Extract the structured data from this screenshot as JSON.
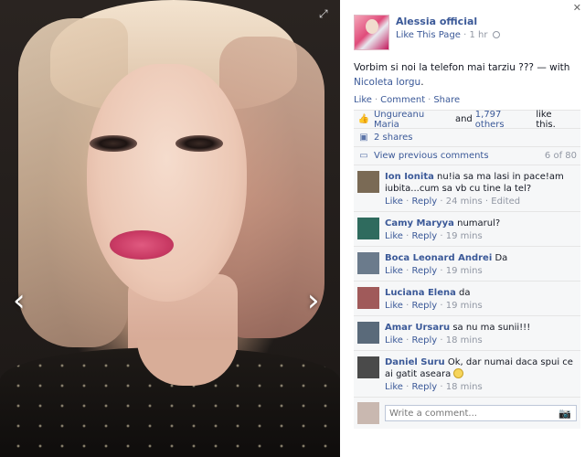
{
  "photo_viewer": {
    "prev_arrow": "‹",
    "next_arrow": "›",
    "expand_glyph": "⤢"
  },
  "post": {
    "author_name": "Alessia official",
    "like_page_label": "Like This Page",
    "separator": "·",
    "time_ago": "1 hr",
    "text": "Vorbim si noi la telefon mai tarziu ??? — with",
    "tagged_name": "Nicoleta Iorgu",
    "tagged_suffix": ".",
    "actions": {
      "like": "Like",
      "comment": "Comment",
      "share": "Share"
    }
  },
  "ufi": {
    "likes_name": "Ungureanu Maria",
    "likes_and": "and",
    "likes_others": "1,797 others",
    "likes_suffix": "like this.",
    "shares": "2 shares",
    "view_previous": "View previous comments",
    "comment_count": "6 of 80"
  },
  "comments": [
    {
      "name": "Ion Ionita",
      "text": "nu!ia sa ma lasi in pace!am iubita...cum sa vb cu tine la tel?",
      "like": "Like",
      "reply": "Reply",
      "time": "24 mins",
      "edited": "Edited",
      "avatar_color": "#7a6a55"
    },
    {
      "name": "Camy Maryya",
      "text": "numarul?",
      "like": "Like",
      "reply": "Reply",
      "time": "19 mins",
      "edited": "",
      "avatar_color": "#2f6b5e"
    },
    {
      "name": "Boca Leonard Andrei",
      "text": "Da",
      "like": "Like",
      "reply": "Reply",
      "time": "19 mins",
      "edited": "",
      "avatar_color": "#6b7b8c"
    },
    {
      "name": "Luciana Elena",
      "text": "da",
      "like": "Like",
      "reply": "Reply",
      "time": "19 mins",
      "edited": "",
      "avatar_color": "#a05a5a"
    },
    {
      "name": "Amar Ursaru",
      "text": "sa nu ma sunii!!!",
      "like": "Like",
      "reply": "Reply",
      "time": "18 mins",
      "edited": "",
      "avatar_color": "#5a6a7a"
    },
    {
      "name": "Daniel Suru",
      "text": "Ok, dar numai daca spui ce ai gatit aseara",
      "like": "Like",
      "reply": "Reply",
      "time": "18 mins",
      "edited": "",
      "avatar_color": "#4a4a4a"
    }
  ],
  "composer": {
    "placeholder": "Write a comment..."
  },
  "colors": {
    "link": "#3b5998",
    "meta": "#9197a3",
    "ufi_bg": "#f6f7f8"
  }
}
